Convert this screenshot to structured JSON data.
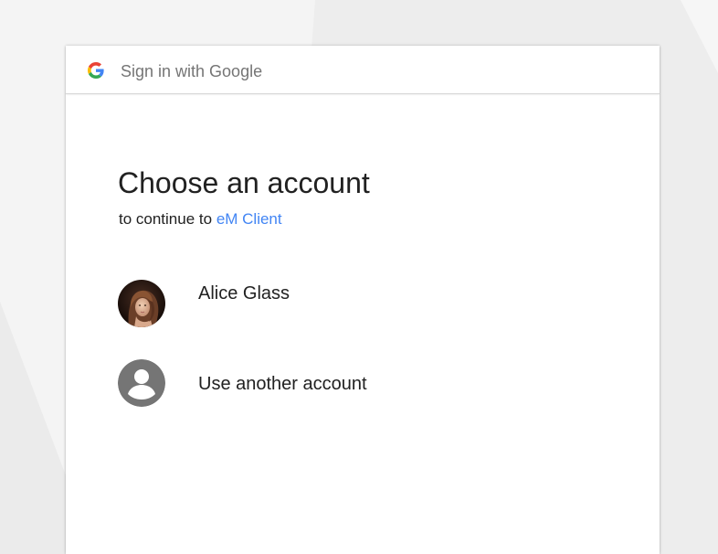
{
  "header": {
    "title": "Sign in with Google",
    "logo_icon": "google-g-icon"
  },
  "main": {
    "heading": "Choose an account",
    "subheading_prefix": "to continue to ",
    "app_name": "eM Client"
  },
  "accounts": [
    {
      "name": "Alice Glass",
      "avatar": "user-photo"
    },
    {
      "name": "Use another account",
      "avatar": "account-circle-icon"
    }
  ],
  "colors": {
    "link": "#4285f4",
    "text_primary": "#212121",
    "text_secondary": "#757575",
    "avatar_gray": "#757575"
  }
}
